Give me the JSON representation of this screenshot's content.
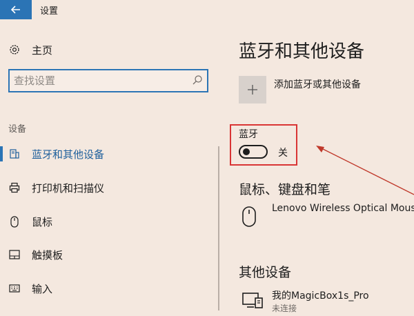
{
  "titlebar": {
    "back_icon": "arrow-left-icon",
    "app_title": "设置"
  },
  "sidebar": {
    "home": {
      "icon": "gear-icon",
      "label": "主页"
    },
    "search": {
      "placeholder": "查找设置",
      "icon": "search-icon"
    },
    "section_label": "设备",
    "items": [
      {
        "label": "蓝牙和其他设备",
        "icon": "bluetooth-devices-icon",
        "active": true
      },
      {
        "label": "打印机和扫描仪",
        "icon": "printer-icon",
        "active": false
      },
      {
        "label": "鼠标",
        "icon": "mouse-icon",
        "active": false
      },
      {
        "label": "触摸板",
        "icon": "touchpad-icon",
        "active": false
      },
      {
        "label": "输入",
        "icon": "keyboard-icon",
        "active": false
      }
    ]
  },
  "main": {
    "title": "蓝牙和其他设备",
    "add_device": {
      "icon": "plus-icon",
      "label": "添加蓝牙或其他设备"
    },
    "bluetooth": {
      "label": "蓝牙",
      "toggle_state": "关",
      "enabled": false
    },
    "sections": [
      {
        "heading": "鼠标、键盘和笔",
        "devices": [
          {
            "name": "Lenovo Wireless Optical Mouse",
            "icon": "mouse-icon",
            "status": ""
          }
        ]
      },
      {
        "heading": "其他设备",
        "devices": [
          {
            "name": "我的MagicBox1s_Pro",
            "icon": "media-device-icon",
            "status": "未连接"
          }
        ]
      }
    ]
  },
  "colors": {
    "accent": "#2b74b5",
    "background": "#f4e8df",
    "highlight_box": "#d93434",
    "annotation_arrow": "#c0392b"
  }
}
